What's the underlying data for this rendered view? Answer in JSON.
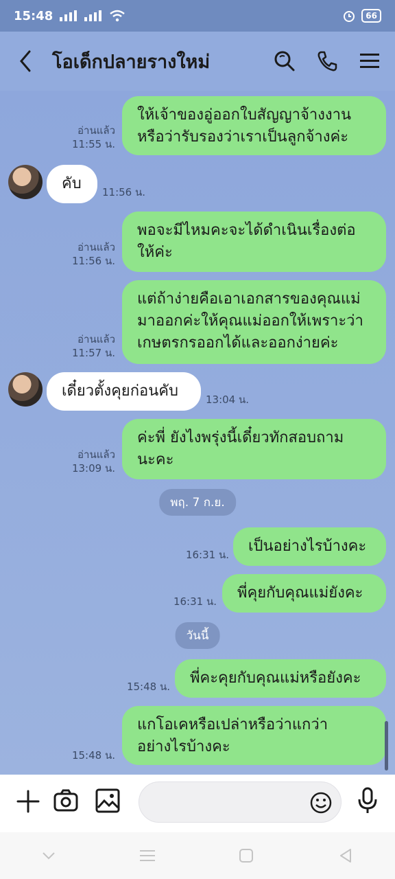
{
  "status": {
    "time": "15:48",
    "battery": "66"
  },
  "header": {
    "title": "โอเด็กปลายรางใหม่"
  },
  "messages": [
    {
      "dir": "out",
      "lines": [
        "ให้เจ้าของอู่ออกใบสัญญาจ้างงาน",
        "หรือว่ารับรองว่าเราเป็นลูกจ้างค่ะ"
      ],
      "read": "อ่านแล้ว",
      "time": "11:55 น."
    },
    {
      "dir": "in",
      "lines": [
        "คับ"
      ],
      "time": "11:56 น."
    },
    {
      "dir": "out",
      "lines": [
        "พอจะมีไหมคะจะได้ดำเนินเรื่องต่อ",
        "ให้ค่ะ"
      ],
      "read": "อ่านแล้ว",
      "time": "11:56 น."
    },
    {
      "dir": "out",
      "lines": [
        "แต่ถ้าง่ายคือเอาเอกสารของคุณแม่",
        "มาออกค่ะให้คุณแม่ออกให้เพราะว่า",
        "เกษตรกรออกได้และออกง่ายค่ะ"
      ],
      "read": "อ่านแล้ว",
      "time": "11:57 น."
    },
    {
      "dir": "in",
      "lines": [
        "เดี๋ยวตั้งคุยก่อนคับ"
      ],
      "time": "13:04 น."
    },
    {
      "dir": "out",
      "lines": [
        "ค่ะพี่ ยังไงพรุ่งนี้เดี๋ยวทักสอบถาม",
        "นะคะ"
      ],
      "read": "อ่านแล้ว",
      "time": "13:09 น."
    },
    {
      "dir": "out",
      "lines": [
        "เป็นอย่างไรบ้างคะ"
      ],
      "time": "16:31 น."
    },
    {
      "dir": "out",
      "lines": [
        "พี่คุยกับคุณแม่ยังคะ"
      ],
      "time": "16:31 น."
    },
    {
      "dir": "out",
      "lines": [
        "พี่คะคุยกับคุณแม่หรือยังคะ"
      ],
      "time": "15:48 น."
    },
    {
      "dir": "out",
      "lines": [
        "แกโอเคหรือเปล่าหรือว่าแกว่า",
        "อย่างไรบ้างคะ"
      ],
      "time": "15:48 น."
    }
  ],
  "dates": [
    "พฤ. 7 ก.ย.",
    "วันนี้"
  ]
}
